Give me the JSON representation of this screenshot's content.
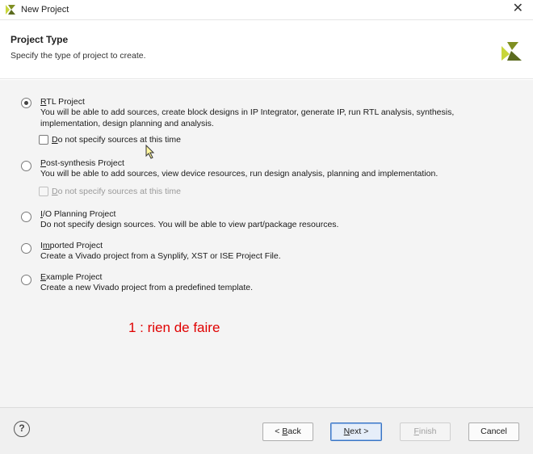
{
  "window": {
    "title": "New Project",
    "close_glyph": "✕",
    "logo_icon": "vivado-logo-icon"
  },
  "header": {
    "title": "Project Type",
    "subtitle": "Specify the type of project to create."
  },
  "options": [
    {
      "title": "RTL Project",
      "mnemonic": "R",
      "rest": "TL Project",
      "desc": "You will be able to add sources, create block designs in IP Integrator, generate IP, run RTL analysis, synthesis, implementation, design planning and analysis.",
      "selected": true,
      "checkbox": {
        "mnemonic": "D",
        "rest": "o not specify sources at this time",
        "checked": false,
        "disabled": false
      }
    },
    {
      "title": "Post-synthesis Project",
      "mnemonic": "P",
      "rest": "ost-synthesis Project",
      "desc": "You will be able to add sources, view device resources, run design analysis, planning and implementation.",
      "selected": false,
      "checkbox": {
        "mnemonic": "D",
        "rest": "o not specify sources at this time",
        "checked": false,
        "disabled": true
      }
    },
    {
      "title": "I/O Planning Project",
      "mnemonic": "I",
      "rest": "/O Planning Project",
      "desc": "Do not specify design sources. You will be able to view part/package resources.",
      "selected": false
    },
    {
      "title": "Imported Project",
      "mnemonic": "m",
      "pre": "I",
      "rest": "ported Project",
      "desc": "Create a Vivado project from a Synplify, XST or ISE Project File.",
      "selected": false
    },
    {
      "title": "Example Project",
      "mnemonic": "E",
      "rest": "xample Project",
      "desc": "Create a new Vivado project from a predefined template.",
      "selected": false
    }
  ],
  "annotation": "1 : rien de faire",
  "footer": {
    "help_glyph": "?",
    "back": {
      "pre": "< ",
      "mnemonic": "B",
      "rest": "ack"
    },
    "next": {
      "mnemonic": "N",
      "rest": "ext >"
    },
    "finish": {
      "mnemonic": "F",
      "rest": "inish"
    },
    "cancel": "Cancel"
  },
  "colors": {
    "accent": "#3a75c4",
    "annotation": "#e00000",
    "logo_dark": "#5b6b1f",
    "logo_light": "#c8d63a"
  }
}
